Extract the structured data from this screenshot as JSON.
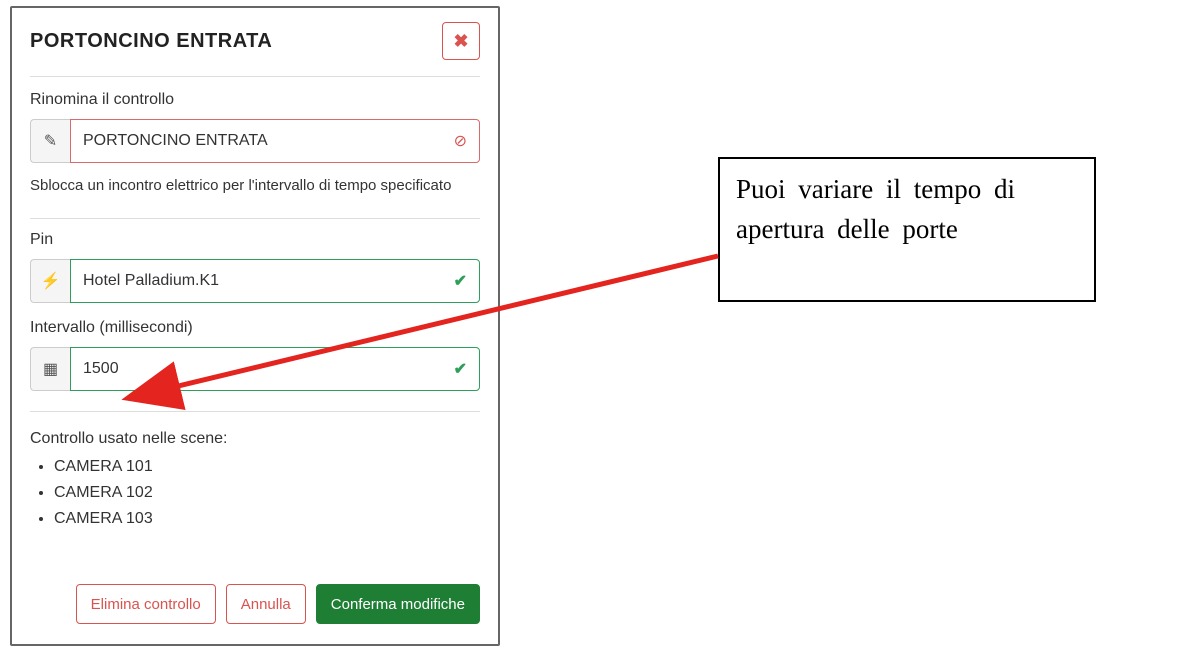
{
  "dialog": {
    "title": "PORTONCINO ENTRATA",
    "close_icon": "✖",
    "rename_label": "Rinomina il controllo",
    "rename_value": "PORTONCINO ENTRATA",
    "edit_icon": "✎",
    "warning_icon": "⊘",
    "helper_text": "Sblocca un incontro elettrico per l'intervallo di tempo specificato",
    "pin_label": "Pin",
    "pin_value": "Hotel Palladium.K1",
    "pin_icon": "⚡",
    "check_icon1": "✔",
    "interval_label": "Intervallo (millisecondi)",
    "interval_value": "1500",
    "interval_icon": "▦",
    "check_icon2": "✔",
    "scenes_heading": "Controllo usato nelle scene:",
    "scenes": [
      "CAMERA 101",
      "CAMERA 102",
      "CAMERA 103"
    ],
    "delete_label": "Elimina controllo",
    "cancel_label": "Annulla",
    "confirm_label": "Conferma modifiche"
  },
  "annotation": {
    "text": "Puoi variare il tempo di apertura delle porte"
  }
}
